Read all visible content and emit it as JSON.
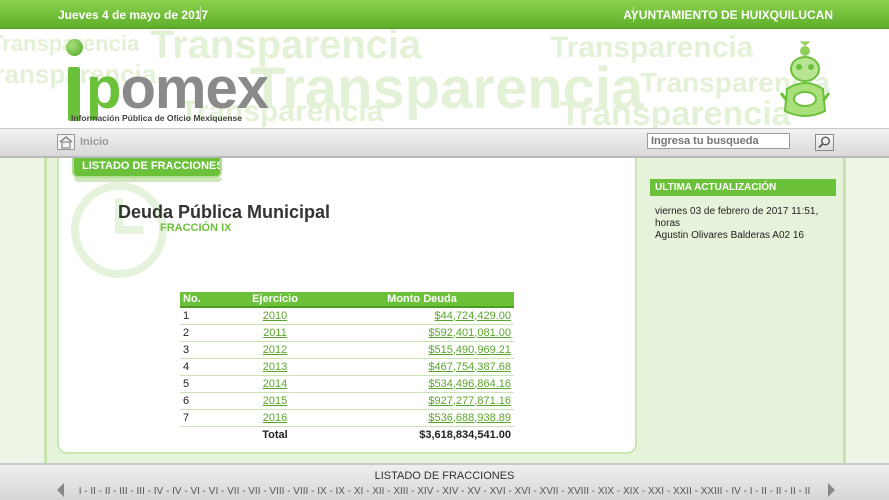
{
  "topbar": {
    "date": "Jueves 4 de mayo de 2017",
    "organization": "AYUNTAMIENTO DE HUIXQUILUCAN"
  },
  "header": {
    "logo_i": "i",
    "logo_rest": "pomex",
    "logo_subtitle": "Información Pública de Oficio Mexiquense",
    "watermark_word": "Transparencia"
  },
  "nav": {
    "home_label": "Inicio",
    "search_placeholder": "Ingresa tu busqueda"
  },
  "main": {
    "tab_label": "LISTADO DE FRACCIONES",
    "title": "Deuda Pública Municipal",
    "subtitle": "FRACCIÓN IX",
    "table": {
      "headers": [
        "No.",
        "Ejercicio",
        "Monto Deuda"
      ],
      "rows": [
        {
          "no": "1",
          "year": "2010",
          "amount": "$44,724,429.00"
        },
        {
          "no": "2",
          "year": "2011",
          "amount": "$592,401,081.00"
        },
        {
          "no": "3",
          "year": "2012",
          "amount": "$515,490,969.21"
        },
        {
          "no": "4",
          "year": "2013",
          "amount": "$467,754,387.68"
        },
        {
          "no": "5",
          "year": "2014",
          "amount": "$534,496,864.16"
        },
        {
          "no": "6",
          "year": "2015",
          "amount": "$927,277,871.16"
        },
        {
          "no": "7",
          "year": "2016",
          "amount": "$536,688,938.89"
        }
      ],
      "total_label": "Total",
      "total_amount": "$3,618,834,541.00"
    }
  },
  "side": {
    "header": "ULTIMA ACTUALIZACIÓN",
    "line1": "viernes 03 de febrero de 2017 11:51,",
    "line2": "horas",
    "line3": "Agustin Olivares Balderas A02 16"
  },
  "footer": {
    "title": "LISTADO DE FRACCIONES",
    "fractions": [
      "I",
      "II",
      "II",
      "III",
      "III",
      "IV",
      "IV",
      "VI",
      "VI",
      "VII",
      "VII",
      "VIII",
      "VIII",
      "IX",
      "IX",
      "XI",
      "XII",
      "XIII",
      "XIV",
      "XIV",
      "XV",
      "XVI",
      "XVI",
      "XVII",
      "XVIII",
      "XIX",
      "XIX",
      "XXI",
      "XXII",
      "XXIII",
      "IV",
      "I",
      "II",
      "II",
      "II",
      "II"
    ]
  },
  "colors": {
    "accent": "#6cc13a",
    "accent_dark": "#4f9a22",
    "link": "#5aa62c"
  }
}
